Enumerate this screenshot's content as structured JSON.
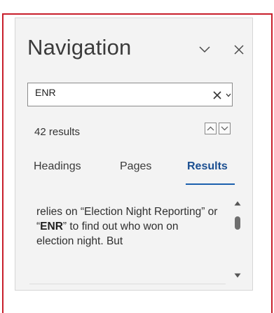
{
  "navigation": {
    "title": "Navigation",
    "search": {
      "value": "ENR",
      "placeholder": ""
    },
    "results_count": "42 results",
    "tabs": [
      {
        "label": "Headings",
        "active": false
      },
      {
        "label": "Pages",
        "active": false
      },
      {
        "label": "Results",
        "active": true
      }
    ],
    "result_snippet": {
      "before": "relies on “Election Night Reporting” or “",
      "highlight": "ENR",
      "after": "” to find out who won on election night. But"
    }
  },
  "colors": {
    "accent": "#1b5fae",
    "frame_border": "#c81e2b",
    "pane_background": "#f3f3f3"
  },
  "icons": {
    "options": "chevron-down-icon",
    "close": "close-icon",
    "clear_search": "x-icon",
    "search_dropdown": "small-chevron-down-icon",
    "previous_result": "caret-up-icon",
    "next_result": "caret-down-icon",
    "scroll_up": "triangle-up-icon",
    "scroll_down": "triangle-down-icon"
  }
}
